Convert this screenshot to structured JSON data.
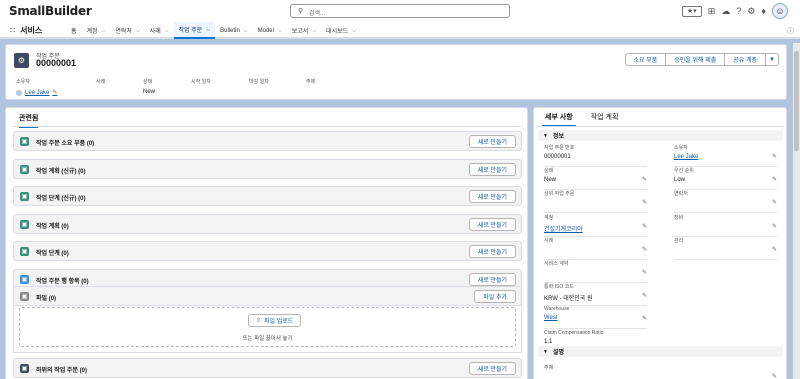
{
  "top": {
    "logo": "SmallBuilder",
    "search_placeholder": "검색..."
  },
  "nav": {
    "app": "서비스",
    "tabs": [
      {
        "label": "홈",
        "has_menu": false
      },
      {
        "label": "계정",
        "has_menu": true
      },
      {
        "label": "연락처",
        "has_menu": true
      },
      {
        "label": "사례",
        "has_menu": true
      },
      {
        "label": "작업 주문",
        "has_menu": true,
        "active": true
      },
      {
        "label": "Bulletin",
        "has_menu": true
      },
      {
        "label": "Model",
        "has_menu": true
      },
      {
        "label": "보고서",
        "has_menu": true
      },
      {
        "label": "대시보드",
        "has_menu": true
      }
    ]
  },
  "header": {
    "type": "작업 주문",
    "name": "00000001",
    "buttons": [
      "소요 부품",
      "승인을 위해 제출",
      "공유 계층"
    ],
    "fields": [
      {
        "label": "소유자",
        "value": "Lee Jake"
      },
      {
        "label": "사례",
        "value": ""
      },
      {
        "label": "상태",
        "value": "New"
      },
      {
        "label": "시작 일자",
        "value": ""
      },
      {
        "label": "마감 일자",
        "value": ""
      },
      {
        "label": "주제",
        "value": ""
      }
    ]
  },
  "related": {
    "tab": "관련됨",
    "lists": [
      {
        "title": "작업 주문 소요 부품 (0)",
        "button": "새로 만들기",
        "color": "#3a8d83"
      },
      {
        "title": "작업 계획 (신규) (0)",
        "button": "새로 만들기",
        "color": "#3a8d83"
      },
      {
        "title": "작업 단계 (신규) (0)",
        "button": "새로 만들기",
        "color": "#3a8d83"
      },
      {
        "title": "작업 계획 (0)",
        "button": "새로 만들기",
        "color": "#3a8d83"
      },
      {
        "title": "작업 단계 (0)",
        "button": "새로 만들기",
        "color": "#3a8d83"
      },
      {
        "title": "작업 주문 행 항목 (0)",
        "button": "새로 만들기",
        "color": "#3b8fd8"
      },
      {
        "title": "파일 (0)",
        "button": "파일 추가",
        "color": "#8a8a8a"
      },
      {
        "title": "하위의 작업 주문 (0)",
        "button": "새로 만들기",
        "color": "#3d4b63"
      }
    ],
    "upload_button": "파일 업로드",
    "drop_text": "또는 파일 끌어서 놓기"
  },
  "details": {
    "tabs": [
      "세부 사항",
      "작업 계획"
    ],
    "section_info": "정보",
    "section_desc": "설명",
    "left_fields": [
      {
        "label": "작업 주문 번호",
        "value": "00000001",
        "editable": false
      },
      {
        "label": "상태",
        "value": "New",
        "editable": true
      },
      {
        "label": "상위 작업 주문",
        "value": "",
        "editable": true
      },
      {
        "label": "계정",
        "value": "건설기계코리아",
        "editable": true,
        "link": true
      },
      {
        "label": "사례",
        "value": "",
        "editable": true
      },
      {
        "label": "서비스 계약",
        "value": "",
        "editable": true
      },
      {
        "label": "통화 ISO 코드",
        "value": "KRW - 대한민국 원",
        "editable": true
      },
      {
        "label": "Warehouse",
        "value": "West",
        "editable": true,
        "link": true
      },
      {
        "label": "Claim Compensation Ratio",
        "value": "1.1",
        "editable": false
      }
    ],
    "right_fields": [
      {
        "label": "소유자",
        "value": "Lee Jake",
        "editable": true,
        "link": true
      },
      {
        "label": "우선 순위",
        "value": "Low",
        "editable": true
      },
      {
        "label": "연락처",
        "value": "",
        "editable": true
      },
      {
        "label": "장비",
        "value": "",
        "editable": true
      },
      {
        "label": "관리",
        "value": "",
        "editable": true
      }
    ],
    "desc_field": {
      "label": "주제",
      "value": ""
    }
  }
}
